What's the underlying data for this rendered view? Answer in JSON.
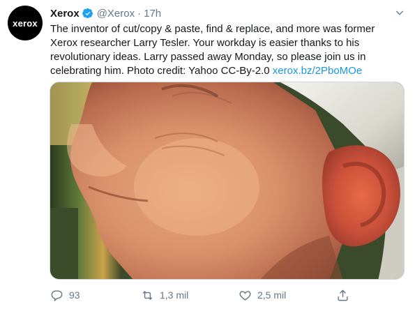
{
  "tweet": {
    "avatar_text": "xerox",
    "display_name": "Xerox",
    "handle": "@Xerox",
    "separator": "·",
    "time": "17h",
    "text_main": "The inventor of cut/copy & paste, find & replace, and more was former Xerox researcher Larry Tesler. Your workday is easier thanks to his revolutionary ideas. Larry passed away Monday, so please join us in celebrating him. Photo credit: Yahoo CC-By-2.0 ",
    "link": "xerox.bz/2PboMOe"
  },
  "actions": {
    "reply_count": "93",
    "retweet_count": "1,3 mil",
    "like_count": "2,5 mil"
  },
  "colors": {
    "link": "#1b95e0",
    "secondary": "#657786",
    "verified": "#1da1f2"
  },
  "icons": [
    "verified-badge-icon",
    "chevron-down-icon",
    "reply-icon",
    "retweet-icon",
    "like-icon",
    "share-icon"
  ]
}
